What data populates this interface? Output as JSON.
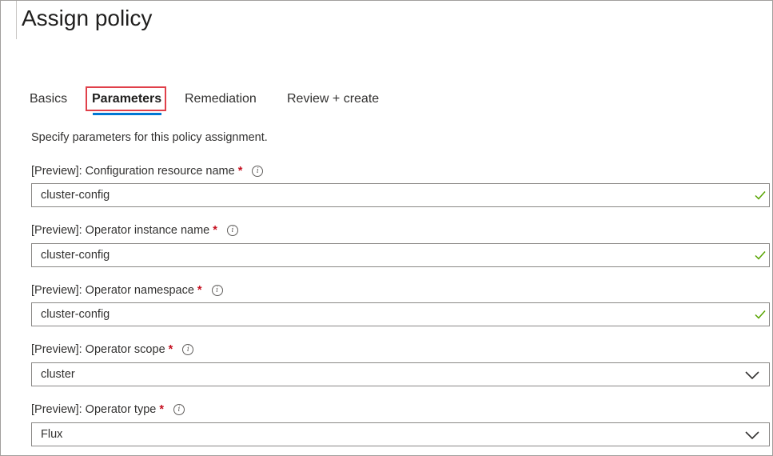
{
  "page": {
    "title": "Assign policy"
  },
  "tabs": [
    {
      "label": "Basics"
    },
    {
      "label": "Parameters"
    },
    {
      "label": "Remediation"
    },
    {
      "label": "Review + create"
    }
  ],
  "intro": "Specify parameters for this policy assignment.",
  "fields": [
    {
      "label": "[Preview]: Configuration resource name",
      "required": "*",
      "value": "cluster-config"
    },
    {
      "label": "[Preview]: Operator instance name",
      "required": "*",
      "value": "cluster-config"
    },
    {
      "label": "[Preview]: Operator namespace",
      "required": "*",
      "value": "cluster-config"
    },
    {
      "label": "[Preview]: Operator scope",
      "required": "*",
      "value": "cluster"
    },
    {
      "label": "[Preview]: Operator type",
      "required": "*",
      "value": "Flux"
    }
  ],
  "colors": {
    "accent": "#0078d4",
    "highlight": "#e0404a",
    "valid": "#57a300",
    "required": "#c50f1f"
  }
}
